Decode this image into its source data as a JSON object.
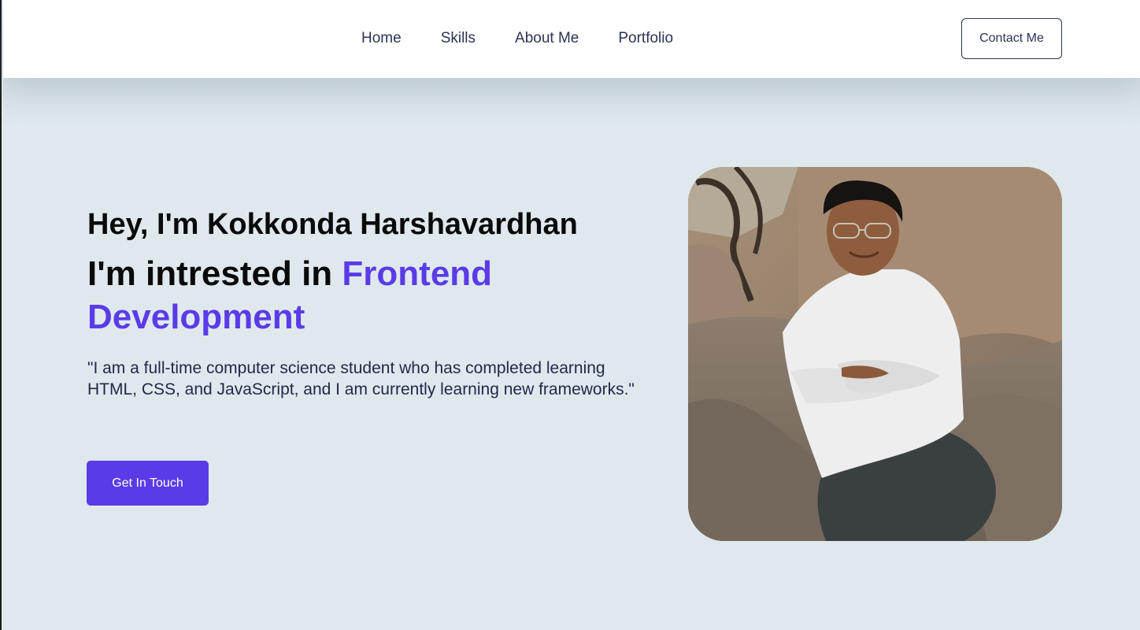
{
  "nav": {
    "links": [
      "Home",
      "Skills",
      "About Me",
      "Portfolio"
    ],
    "contact_label": "Contact Me"
  },
  "hero": {
    "greeting": "Hey, I'm Kokkonda Harshavardhan",
    "headline_prefix": "I'm intrested in ",
    "headline_highlight": "Frontend Development",
    "bio": "\"I am a full-time computer science student who has completed learning HTML, CSS, and JavaScript, and I am currently learning new frameworks.\"",
    "cta_label": "Get In Touch"
  },
  "colors": {
    "accent": "#5b3be8",
    "navy_text": "#2c3354",
    "hero_bg": "#dfe9ed",
    "nav_bg": "#ffffff"
  }
}
